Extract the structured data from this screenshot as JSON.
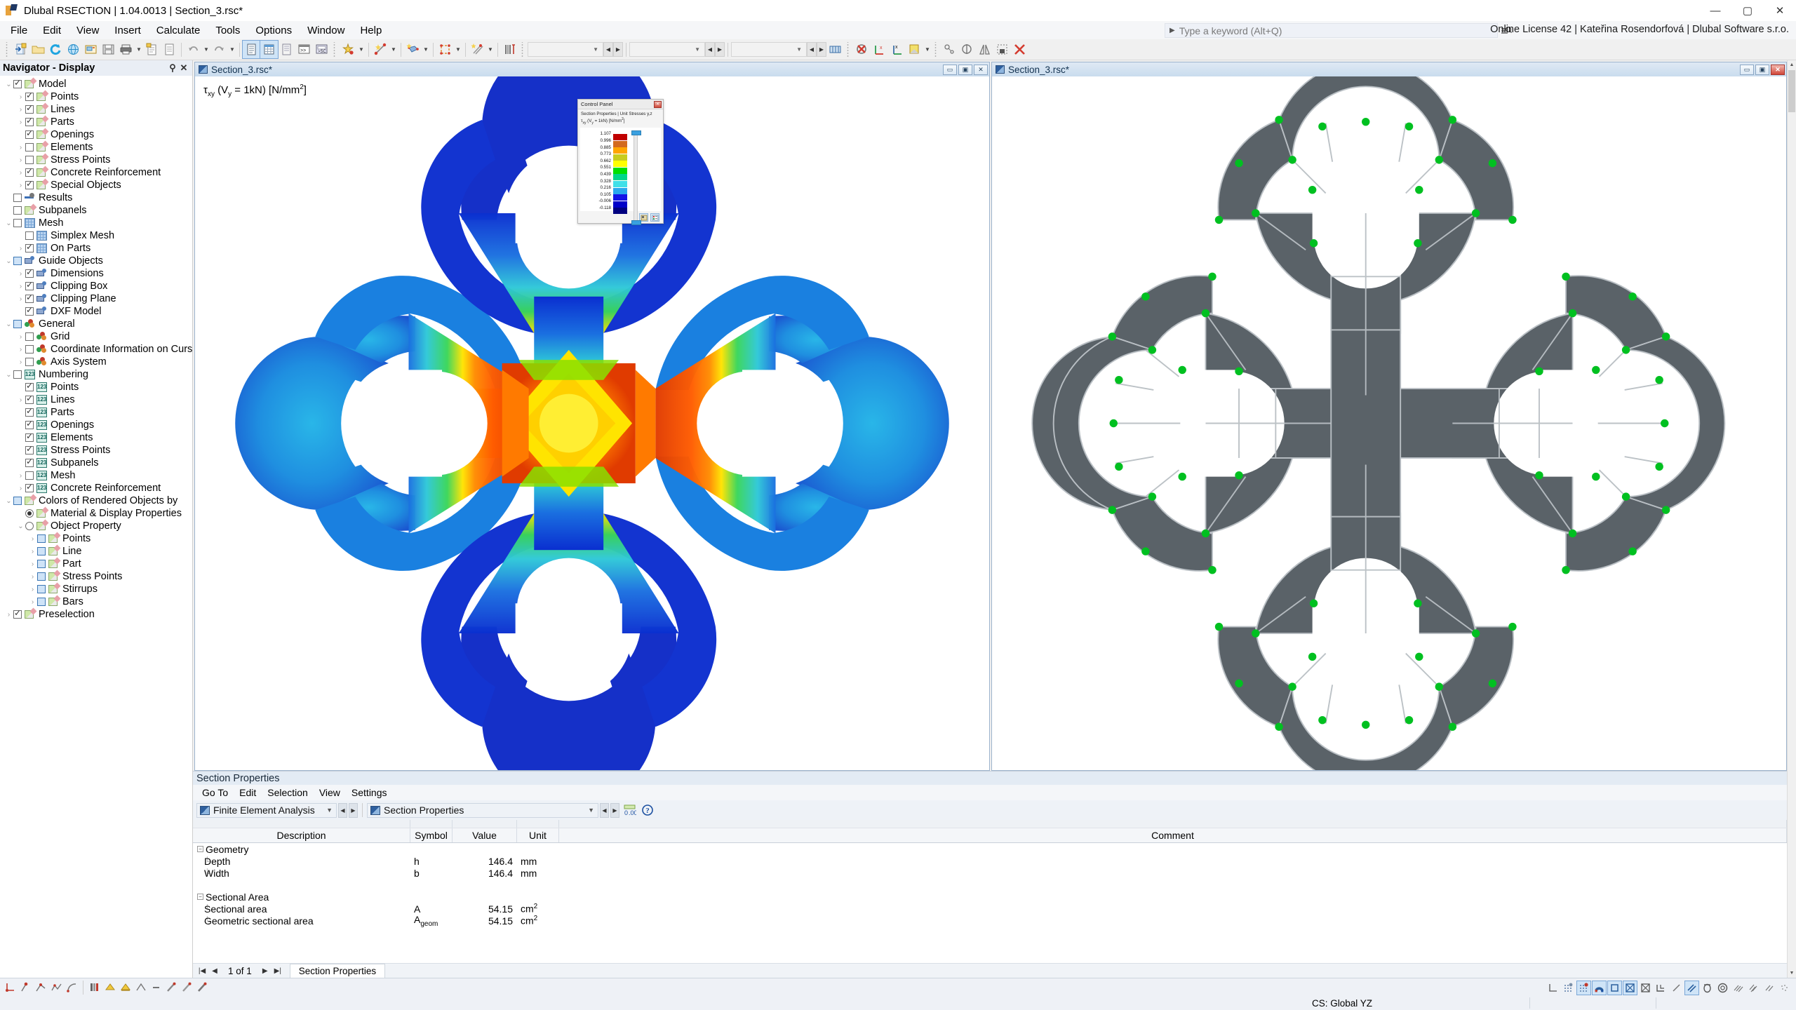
{
  "titlebar": {
    "title": "Dlubal RSECTION | 1.04.0013 | Section_3.rsc*",
    "minimize": "—",
    "maximize": "▢",
    "close": "✕"
  },
  "menubar": {
    "items": [
      "File",
      "Edit",
      "View",
      "Insert",
      "Calculate",
      "Tools",
      "Options",
      "Window",
      "Help"
    ],
    "keyword_placeholder": "Type a keyword (Alt+Q)",
    "license": "Online License 42 | Kateřina Rosendorfová | Dlubal Software s.r.o."
  },
  "navigator": {
    "title": "Navigator - Display",
    "pin": "⚲",
    "close": "✕",
    "items": [
      {
        "label": "Model",
        "indent": 0,
        "exp": "v",
        "check": "checked",
        "icon": "ruler"
      },
      {
        "label": "Points",
        "indent": 1,
        "exp": ">",
        "check": "checked",
        "icon": "ruler"
      },
      {
        "label": "Lines",
        "indent": 1,
        "exp": ">",
        "check": "checked",
        "icon": "ruler"
      },
      {
        "label": "Parts",
        "indent": 1,
        "exp": ">",
        "check": "checked",
        "icon": "ruler"
      },
      {
        "label": "Openings",
        "indent": 1,
        "exp": "",
        "check": "checked",
        "icon": "ruler"
      },
      {
        "label": "Elements",
        "indent": 1,
        "exp": ">",
        "check": "unchecked",
        "icon": "ruler"
      },
      {
        "label": "Stress Points",
        "indent": 1,
        "exp": ">",
        "check": "unchecked",
        "icon": "ruler"
      },
      {
        "label": "Concrete Reinforcement",
        "indent": 1,
        "exp": ">",
        "check": "checked",
        "icon": "ruler"
      },
      {
        "label": "Special Objects",
        "indent": 1,
        "exp": ">",
        "check": "checked",
        "icon": "ruler"
      },
      {
        "label": "Results",
        "indent": 0,
        "exp": "",
        "check": "unchecked",
        "icon": "res"
      },
      {
        "label": "Subpanels",
        "indent": 0,
        "exp": "",
        "check": "unchecked",
        "icon": "ruler"
      },
      {
        "label": "Mesh",
        "indent": 0,
        "exp": "v",
        "check": "unchecked",
        "icon": "mesh"
      },
      {
        "label": "Simplex Mesh",
        "indent": 1,
        "exp": "",
        "check": "unchecked",
        "icon": "mesh"
      },
      {
        "label": "On Parts",
        "indent": 1,
        "exp": ">",
        "check": "checked",
        "icon": "mesh"
      },
      {
        "label": "Guide Objects",
        "indent": 0,
        "exp": "v",
        "check": "partial",
        "icon": "guide"
      },
      {
        "label": "Dimensions",
        "indent": 1,
        "exp": ">",
        "check": "checked",
        "icon": "guide"
      },
      {
        "label": "Clipping Box",
        "indent": 1,
        "exp": ">",
        "check": "checked",
        "icon": "guide"
      },
      {
        "label": "Clipping Plane",
        "indent": 1,
        "exp": ">",
        "check": "checked",
        "icon": "guide"
      },
      {
        "label": "DXF Model",
        "indent": 1,
        "exp": "",
        "check": "checked",
        "icon": "guide"
      },
      {
        "label": "General",
        "indent": 0,
        "exp": "v",
        "check": "partial",
        "icon": "gen"
      },
      {
        "label": "Grid",
        "indent": 1,
        "exp": ">",
        "check": "unchecked",
        "icon": "gen"
      },
      {
        "label": "Coordinate Information on Cursor",
        "indent": 1,
        "exp": ">",
        "check": "unchecked",
        "icon": "gen"
      },
      {
        "label": "Axis System",
        "indent": 1,
        "exp": ">",
        "check": "unchecked",
        "icon": "gen"
      },
      {
        "label": "Numbering",
        "indent": 0,
        "exp": "v",
        "check": "unchecked",
        "icon": "num"
      },
      {
        "label": "Points",
        "indent": 1,
        "exp": "",
        "check": "checked",
        "icon": "num"
      },
      {
        "label": "Lines",
        "indent": 1,
        "exp": ">",
        "check": "checked",
        "icon": "num"
      },
      {
        "label": "Parts",
        "indent": 1,
        "exp": "",
        "check": "checked",
        "icon": "num"
      },
      {
        "label": "Openings",
        "indent": 1,
        "exp": "",
        "check": "checked",
        "icon": "num"
      },
      {
        "label": "Elements",
        "indent": 1,
        "exp": "",
        "check": "checked",
        "icon": "num"
      },
      {
        "label": "Stress Points",
        "indent": 1,
        "exp": "",
        "check": "checked",
        "icon": "num"
      },
      {
        "label": "Subpanels",
        "indent": 1,
        "exp": "",
        "check": "checked",
        "icon": "num"
      },
      {
        "label": "Mesh",
        "indent": 1,
        "exp": ">",
        "check": "unchecked",
        "icon": "num"
      },
      {
        "label": "Concrete Reinforcement",
        "indent": 1,
        "exp": ">",
        "check": "checked",
        "icon": "num"
      },
      {
        "label": "Colors of Rendered Objects by",
        "indent": 0,
        "exp": "v",
        "check": "partial",
        "icon": "ruler"
      },
      {
        "label": "Material & Display Properties",
        "indent": 1,
        "exp": "",
        "check": "radio-on",
        "icon": "ruler"
      },
      {
        "label": "Object Property",
        "indent": 1,
        "exp": "v",
        "check": "radio-off",
        "icon": "ruler"
      },
      {
        "label": "Points",
        "indent": 2,
        "exp": ">",
        "check": "partial",
        "icon": "ruler"
      },
      {
        "label": "Line",
        "indent": 2,
        "exp": ">",
        "check": "partial",
        "icon": "ruler"
      },
      {
        "label": "Part",
        "indent": 2,
        "exp": ">",
        "check": "partial",
        "icon": "ruler"
      },
      {
        "label": "Stress Points",
        "indent": 2,
        "exp": ">",
        "check": "partial",
        "icon": "ruler"
      },
      {
        "label": "Stirrups",
        "indent": 2,
        "exp": ">",
        "check": "partial",
        "icon": "ruler"
      },
      {
        "label": "Bars",
        "indent": 2,
        "exp": ">",
        "check": "partial",
        "icon": "ruler"
      },
      {
        "label": "Preselection",
        "indent": 0,
        "exp": ">",
        "check": "checked",
        "icon": "ruler"
      }
    ]
  },
  "viewport_left": {
    "title": "Section_3.rsc*",
    "result_label_main": "τ",
    "result_label_sub": "xy",
    "result_label_rest": " (V",
    "result_label_sub2": "y",
    "result_label_rest2": " = 1kN) [N/mm",
    "result_label_sup": "2",
    "result_label_end": "]",
    "minimize": "▭",
    "restore": "▣",
    "close": "✕"
  },
  "viewport_right": {
    "title": "Section_3.rsc*",
    "minimize": "▭",
    "restore": "▣",
    "close": "✕"
  },
  "control_panel": {
    "title": "Control Panel",
    "close": "✕",
    "subtitle_line1": "Section Properties | Unit Stresses y,z",
    "subtitle_line2_a": "τ",
    "subtitle_line2_sub": "xy",
    "subtitle_line2_b": " (V",
    "subtitle_line2_sub2": "y",
    "subtitle_line2_c": " = 1kN) [N/mm",
    "subtitle_line2_sup": "2",
    "subtitle_line2_d": "]",
    "legend_values": [
      "1.107",
      "0.996",
      "0.885",
      "0.773",
      "0.662",
      "0.551",
      "0.439",
      "0.328",
      "0.216",
      "0.105",
      "-0.006",
      "-0.118"
    ],
    "legend_colors": [
      "#c00000",
      "#d2691e",
      "#ffa500",
      "#c8cc1e",
      "#ffff00",
      "#00e000",
      "#00d68a",
      "#40e0e8",
      "#2aa8ee",
      "#1414e6",
      "#0000c8",
      "#000080"
    ]
  },
  "chart_data": {
    "type": "heatmap",
    "title": "Section Properties | Unit Stresses y,z",
    "subtitle": "τxy (Vy = 1kN) [N/mm²]",
    "unit": "N/mm²",
    "legend_position": "control-panel",
    "scale_min": -0.118,
    "scale_max": 1.107,
    "scale_ticks": [
      1.107,
      0.996,
      0.885,
      0.773,
      0.662,
      0.551,
      0.439,
      0.328,
      0.216,
      0.105,
      -0.006,
      -0.118
    ],
    "colors": [
      "#c00000",
      "#d2691e",
      "#ffa500",
      "#c8cc1e",
      "#ffff00",
      "#00e000",
      "#00d68a",
      "#40e0e8",
      "#2aa8ee",
      "#1414e6",
      "#0000c8",
      "#000080"
    ]
  },
  "dock": {
    "title": "Section Properties",
    "menu": [
      "Go To",
      "Edit",
      "Selection",
      "View",
      "Settings"
    ],
    "selector1": "Finite Element Analysis",
    "selector2": "Section Properties",
    "columns": [
      "Description",
      "Symbol",
      "Value",
      "Unit",
      "Comment"
    ],
    "rows": [
      {
        "type": "group",
        "description": "Geometry",
        "symbol": "",
        "value": "",
        "unit": ""
      },
      {
        "type": "item",
        "description": "Depth",
        "symbol": "h",
        "value": "146.4",
        "unit": "mm"
      },
      {
        "type": "item",
        "description": "Width",
        "symbol": "b",
        "value": "146.4",
        "unit": "mm"
      },
      {
        "type": "blank",
        "description": "",
        "symbol": "",
        "value": "",
        "unit": ""
      },
      {
        "type": "group",
        "description": "Sectional Area",
        "symbol": "",
        "value": "",
        "unit": ""
      },
      {
        "type": "item",
        "description": "Sectional area",
        "symbol": "A",
        "value": "54.15",
        "unit": "cm²"
      },
      {
        "type": "item",
        "description": "Geometric sectional area",
        "symbol": "Ageom",
        "value": "54.15",
        "unit": "cm²"
      }
    ],
    "pager": {
      "first": "|◀",
      "prev": "◀",
      "text": "1 of 1",
      "next": "▶",
      "last": "▶|",
      "tab": "Section Properties"
    }
  },
  "statusbar": {
    "cs_text": "CS: Global YZ"
  }
}
